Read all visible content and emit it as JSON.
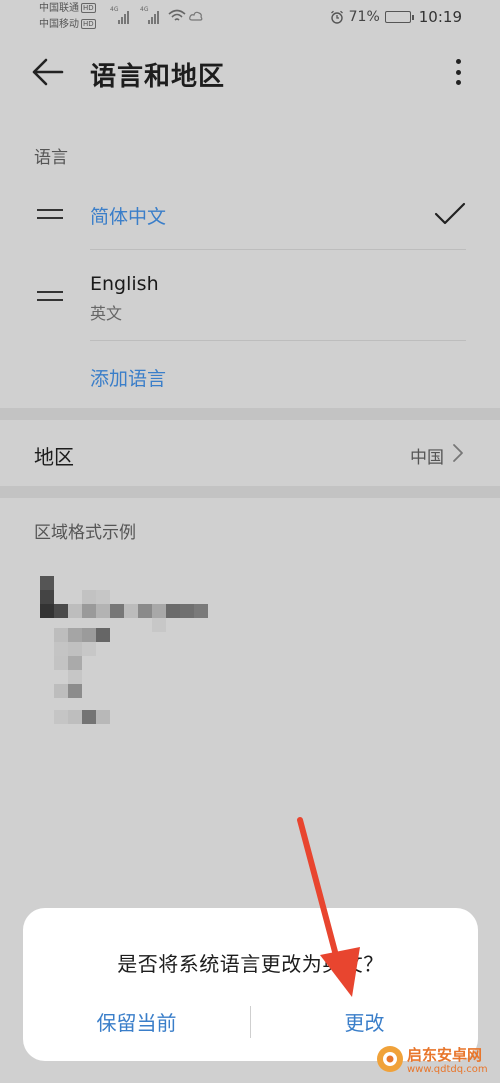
{
  "status_bar": {
    "carrier_1": "中国联通",
    "carrier_2": "中国移动",
    "hd_badge": "HD",
    "network_1": "4G",
    "network_2": "4G",
    "battery": "71%",
    "battery_level": 0.71,
    "time": "10:19"
  },
  "header": {
    "title": "语言和地区"
  },
  "language_section": {
    "label": "语言",
    "items": [
      {
        "name": "简体中文",
        "subtitle": "",
        "selected": true
      },
      {
        "name": "English",
        "subtitle": "英文",
        "selected": false
      }
    ],
    "add_label": "添加语言"
  },
  "region": {
    "label": "地区",
    "value": "中国"
  },
  "format_section": {
    "label": "区域格式示例"
  },
  "dialog": {
    "message": "是否将系统语言更改为英文？",
    "keep_label": "保留当前",
    "change_label": "更改"
  },
  "watermark": {
    "name": "启东安卓网",
    "url": "www.qdtdq.com"
  },
  "colors": {
    "accent": "#3a7ec9",
    "background": "#d0d0d0",
    "arrow": "#e8452f",
    "watermark": "#e8762c"
  },
  "icons": {
    "back": "arrow-left-icon",
    "more": "more-vertical-icon",
    "check": "check-icon",
    "drag": "drag-handle-icon",
    "chevron": "chevron-right-icon"
  }
}
